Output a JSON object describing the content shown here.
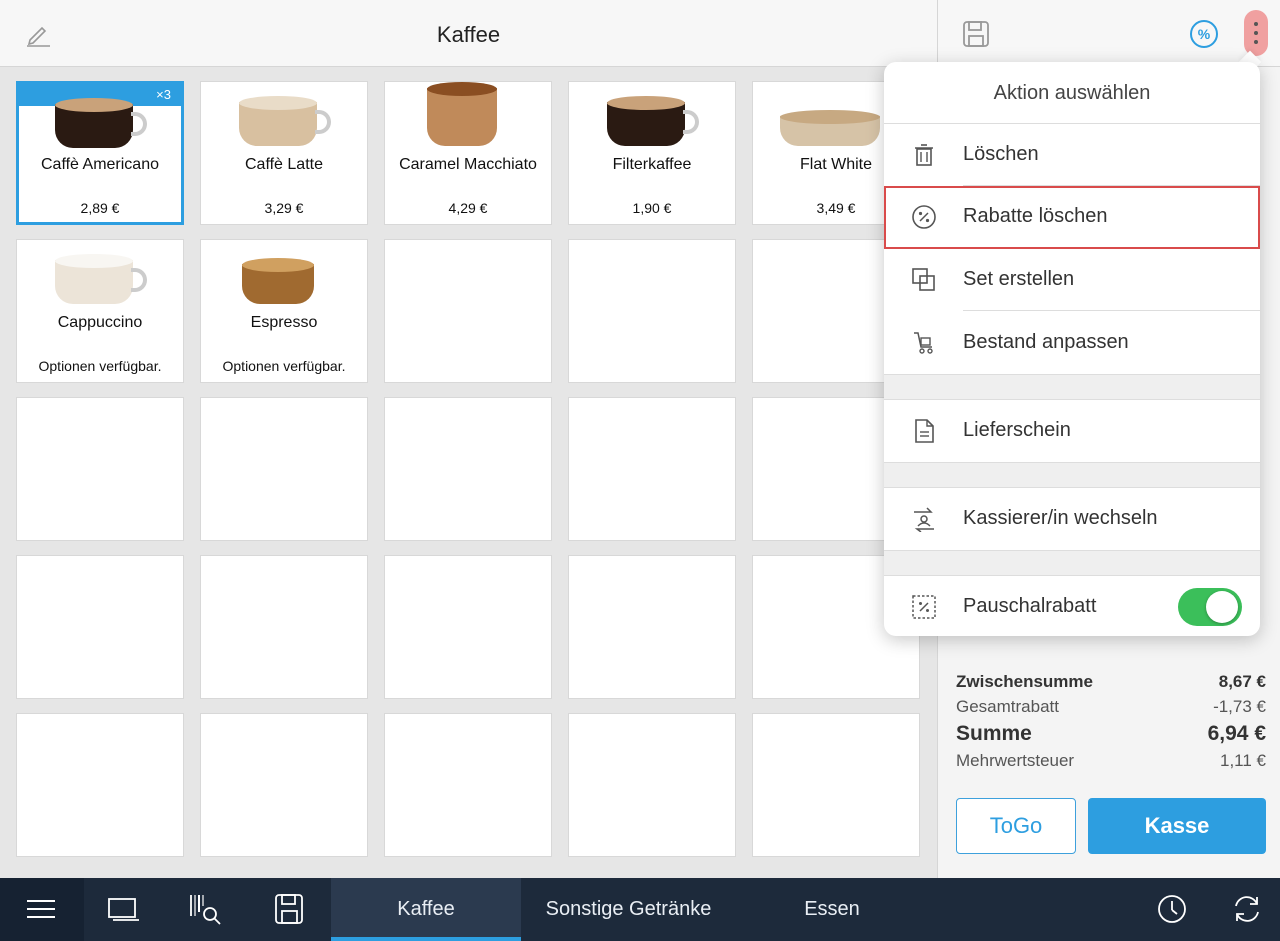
{
  "header": {
    "title": "Kaffee",
    "edit_icon": "pencil-icon"
  },
  "right_header": {
    "save_icon": "save-icon",
    "discount_icon": "percent-icon",
    "more_icon": "more-vertical-icon"
  },
  "products": [
    {
      "name": "Caffè Americano",
      "price": "2,89 €",
      "badge": "×3",
      "selected": true,
      "cup": "dark-mug"
    },
    {
      "name": "Caffè Latte",
      "price": "3,29 €",
      "cup": "latte-mug"
    },
    {
      "name": "Caramel Macchiato",
      "price": "4,29 €",
      "cup": "caramel-glass"
    },
    {
      "name": "Filterkaffee",
      "price": "1,90 €",
      "cup": "dark-mug"
    },
    {
      "name": "Flat White",
      "price": "3,49 €",
      "cup": "flat-cup"
    },
    {
      "name": "Cappuccino",
      "price": "Optionen verfügbar.",
      "cup": "foam-mug"
    },
    {
      "name": "Espresso",
      "price": "Optionen verfügbar.",
      "cup": "espresso-glass"
    }
  ],
  "menu": {
    "title": "Aktion auswählen",
    "items": [
      {
        "label": "Löschen",
        "icon": "trash-icon"
      },
      {
        "label": "Rabatte löschen",
        "icon": "percent-circle-icon"
      },
      {
        "label": "Set erstellen",
        "icon": "layers-icon"
      },
      {
        "label": "Bestand anpassen",
        "icon": "cart-icon"
      },
      {
        "label": "Lieferschein",
        "icon": "document-icon"
      },
      {
        "label": "Kassierer/in wechseln",
        "icon": "switch-user-icon"
      },
      {
        "label": "Pauschalrabatt",
        "icon": "percent-square-icon",
        "toggle": true
      }
    ]
  },
  "summary": {
    "subtotal_label": "Zwischensumme",
    "subtotal": "8,67 €",
    "discount_label": "Gesamtrabatt",
    "discount": "-1,73 €",
    "total_label": "Summe",
    "total": "6,94 €",
    "vat_label": "Mehrwertsteuer",
    "vat": "1,11 €"
  },
  "buttons": {
    "togo": "ToGo",
    "checkout": "Kasse"
  },
  "bottom_tabs": [
    {
      "label": "Kaffee",
      "active": true
    },
    {
      "label": "Sonstige Getränke"
    },
    {
      "label": "Essen"
    }
  ],
  "bottom_icons": [
    "hamburger-menu-icon",
    "tablet-icon",
    "barcode-search-icon",
    "save-icon",
    "clock-icon",
    "sync-icon"
  ],
  "colors": {
    "accent": "#2d9ee0",
    "toggle_on": "#3bbf5a",
    "highlight": "#d94b4b",
    "bottom_bar": "#1d2a3b"
  }
}
